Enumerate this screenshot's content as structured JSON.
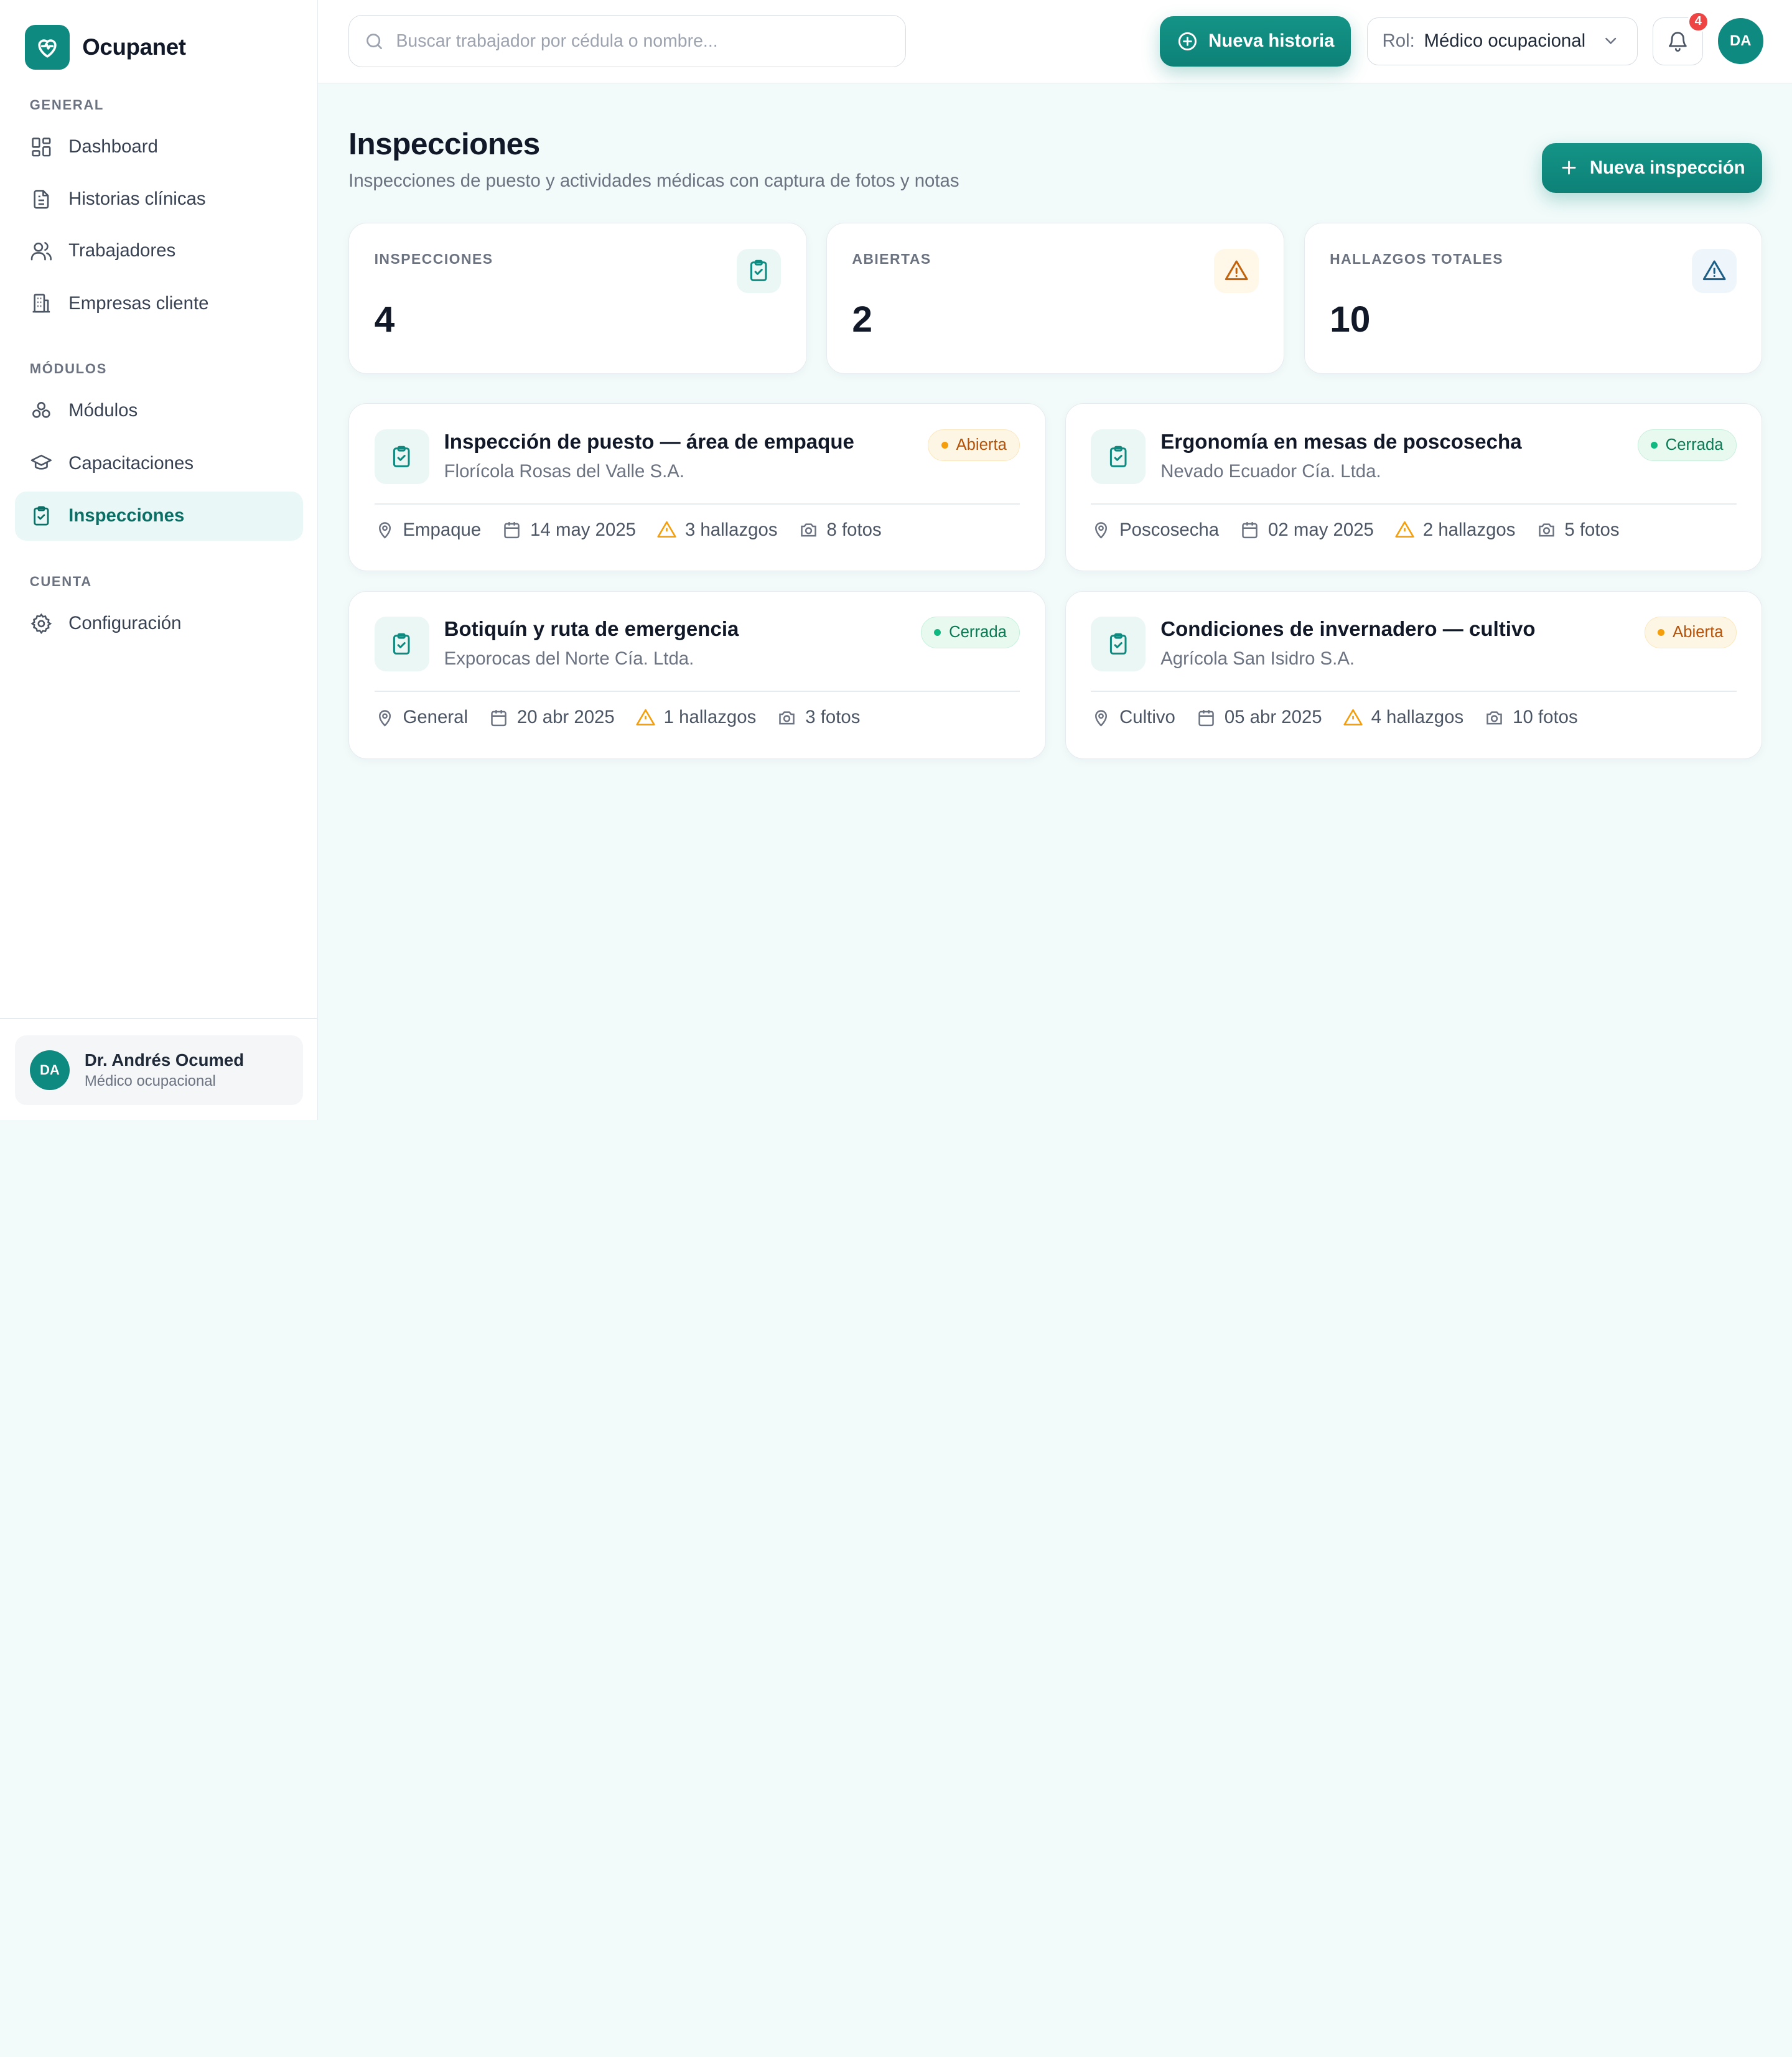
{
  "brand": {
    "name": "Ocupanet"
  },
  "sidebar": {
    "sections": [
      {
        "title": "GENERAL"
      },
      {
        "title": "MÓDULOS"
      },
      {
        "title": "CUENTA"
      }
    ],
    "items": [
      {
        "label": "Dashboard",
        "icon": "dashboard-icon"
      },
      {
        "label": "Historias clínicas",
        "icon": "document-icon"
      },
      {
        "label": "Trabajadores",
        "icon": "users-icon"
      },
      {
        "label": "Empresas cliente",
        "icon": "building-icon"
      },
      {
        "label": "Módulos",
        "icon": "modules-icon"
      },
      {
        "label": "Capacitaciones",
        "icon": "graduation-cap-icon"
      },
      {
        "label": "Inspecciones",
        "icon": "clipboard-check-icon",
        "active": true
      },
      {
        "label": "Configuración",
        "icon": "gear-icon"
      }
    ],
    "user": {
      "initials": "DA",
      "name": "Dr. Andrés Ocumed",
      "role": "Médico ocupacional"
    }
  },
  "topbar": {
    "search_placeholder": "Buscar trabajador por cédula o nombre...",
    "new_history_label": "Nueva historia",
    "role_prefix": "Rol:",
    "role_value": "Médico ocupacional",
    "notifications_count": "4",
    "avatar_initials": "DA"
  },
  "page": {
    "title": "Inspecciones",
    "subtitle": "Inspecciones de puesto y actividades médicas con captura de fotos y notas",
    "new_button_label": "Nueva inspección"
  },
  "stats": [
    {
      "label": "INSPECCIONES",
      "value": "4",
      "icon": "clipboard-check-icon",
      "color": "#0f8a80"
    },
    {
      "label": "ABIERTAS",
      "value": "2",
      "icon": "warning-icon",
      "color": "#c2620a"
    },
    {
      "label": "HALLAZGOS TOTALES",
      "value": "10",
      "icon": "alert-triangle-icon",
      "color": "#1d5f86"
    }
  ],
  "inspections": [
    {
      "title": "Inspección de puesto — área de empaque",
      "company": "Florícola Rosas del Valle S.A.",
      "status": "Abierta",
      "area": "Empaque",
      "date": "14 may 2025",
      "findings": "3 hallazgos",
      "photos": "8 fotos"
    },
    {
      "title": "Ergonomía en mesas de poscosecha",
      "company": "Nevado Ecuador Cía. Ltda.",
      "status": "Cerrada",
      "area": "Poscosecha",
      "date": "02 may 2025",
      "findings": "2 hallazgos",
      "photos": "5 fotos"
    },
    {
      "title": "Botiquín y ruta de emergencia",
      "company": "Exporocas del Norte Cía. Ltda.",
      "status": "Cerrada",
      "area": "General",
      "date": "20 abr 2025",
      "findings": "1 hallazgos",
      "photos": "3 fotos"
    },
    {
      "title": "Condiciones de invernadero — cultivo",
      "company": "Agrícola San Isidro S.A.",
      "status": "Abierta",
      "area": "Cultivo",
      "date": "05 abr 2025",
      "findings": "4 hallazgos",
      "photos": "10 fotos"
    }
  ],
  "colors": {
    "accent": "#0f8a80",
    "background": "#f2fbfa",
    "open": "#f59e0b",
    "closed": "#10b981",
    "badge": "#ef4444"
  }
}
